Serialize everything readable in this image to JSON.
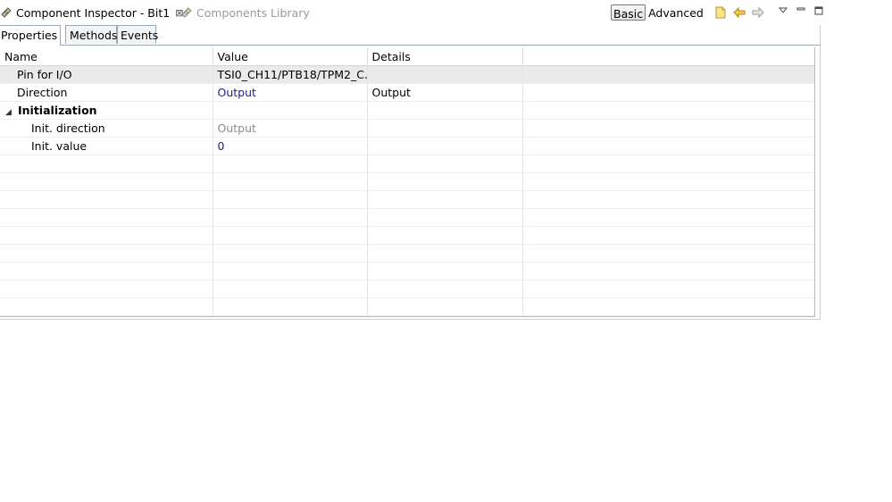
{
  "view_tabs": {
    "active": {
      "label": "Component Inspector - Bit1",
      "icon": "component-icon",
      "close_glyph": "⊠"
    },
    "inactive": {
      "label": "Components Library",
      "icon": "component-icon"
    }
  },
  "toolbar": {
    "basic_label": "Basic",
    "advanced_label": "Advanced",
    "icons": [
      "new-note-icon",
      "back-arrow-icon",
      "forward-arrow-icon",
      "view-menu-icon",
      "minimize-icon",
      "maximize-icon"
    ]
  },
  "subtabs": [
    "Properties",
    "Methods",
    "Events"
  ],
  "grid": {
    "headers": [
      "Name",
      "Value",
      "Details"
    ],
    "rows": [
      {
        "name": "Pin for I/O",
        "value": "TSI0_CH11/PTB18/TPM2_C...",
        "details": "",
        "selected": true
      },
      {
        "name": "Direction",
        "value": "Output",
        "details": "Output"
      },
      {
        "name": "Initialization",
        "value": "",
        "details": "",
        "group": true,
        "toggle": "◢"
      },
      {
        "name": "Init. direction",
        "value": "Output",
        "details": ""
      },
      {
        "name": "Init. value",
        "value": "0",
        "details": ""
      }
    ]
  },
  "colors": {
    "value_blue": "#1c1c96",
    "value_gray": "#8c8c8c",
    "selection": "#eaeaea"
  }
}
